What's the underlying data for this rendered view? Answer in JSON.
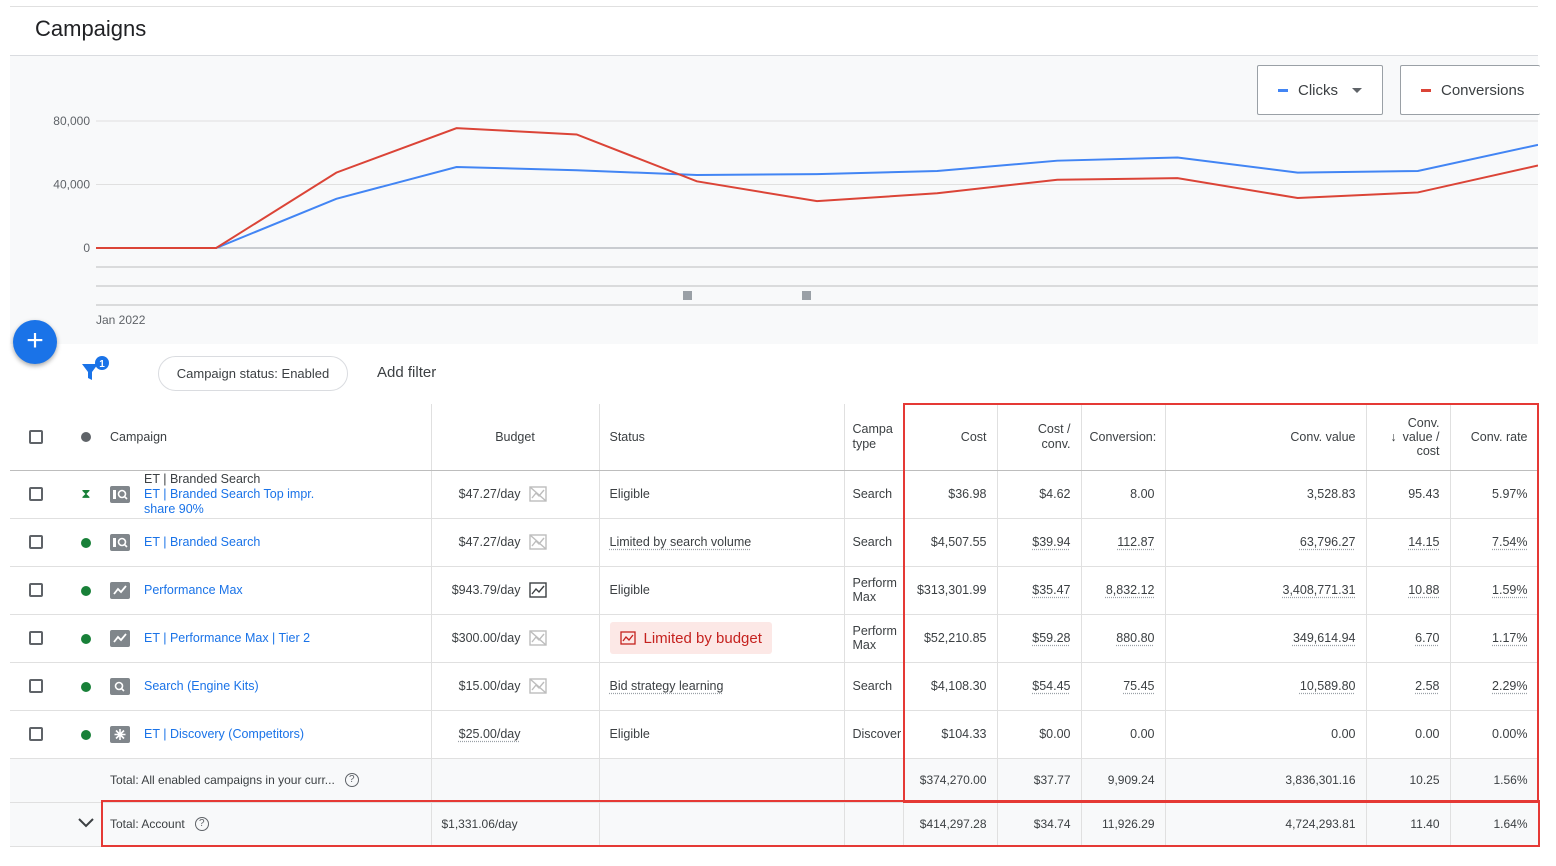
{
  "page": {
    "title": "Campaigns"
  },
  "chart": {
    "metrics": [
      {
        "label": "Clicks",
        "color": "#4285f4",
        "has_dropdown": true
      },
      {
        "label": "Conversions",
        "color": "#db4437",
        "has_dropdown": false
      }
    ],
    "y_tick_labels": [
      "80,000",
      "40,000",
      "0"
    ],
    "x_tick_label": "Jan 2022"
  },
  "chart_data": {
    "type": "line",
    "title": "",
    "xlabel": "",
    "ylabel": "",
    "x_start_label": "Jan 2022",
    "ylim": [
      0,
      80000
    ],
    "y_ticks": [
      0,
      40000,
      80000
    ],
    "grid": true,
    "x": [
      0,
      1,
      2,
      3,
      4,
      5,
      6,
      7,
      8,
      9,
      10,
      11,
      12
    ],
    "series": [
      {
        "name": "Clicks",
        "color": "#4285f4",
        "values": [
          0,
          0,
          31000,
          51000,
          49000,
          46000,
          46500,
          48500,
          55000,
          57000,
          47500,
          48500,
          65000
        ]
      },
      {
        "name": "Conversions",
        "color": "#db4437",
        "values": [
          0,
          0,
          47500,
          75500,
          71500,
          42000,
          29500,
          34500,
          43000,
          44000,
          31500,
          35000,
          52000
        ]
      }
    ]
  },
  "filters": {
    "active_count": "1",
    "chip_label": "Campaign status: Enabled",
    "add_filter_label": "Add filter"
  },
  "table": {
    "headers": {
      "campaign": "Campaign",
      "budget": "Budget",
      "status": "Status",
      "campaign_type_1": "Campa",
      "campaign_type_2": "type",
      "cost": "Cost",
      "cost_conv_1": "Cost /",
      "cost_conv_2": "conv.",
      "conversions": "Conversion:",
      "conv_value": "Conv. value",
      "value_cost_1": "Conv.",
      "value_cost_2": "value /",
      "value_cost_3": "cost",
      "sort_arrow": "↓",
      "conv_rate": "Conv. rate"
    },
    "rows": [
      {
        "status_icon": "hourglass-icon",
        "type_icon": "search-icon",
        "name_line1": "ET | Branded Search",
        "name_line2": "ET | Branded Search Top impr.",
        "name_line3": "share 90%",
        "budget": "$47.27/day",
        "budget_icon": "chart-disabled-icon",
        "status": "Eligible",
        "type": "Search",
        "cost": "$36.98",
        "cost_conv": "$4.62",
        "conversions": "8.00",
        "conv_value": "3,528.83",
        "value_cost": "95.43",
        "conv_rate": "5.97%"
      },
      {
        "status_icon": "green-dot",
        "type_icon": "search-icon",
        "name": "ET | Branded Search",
        "budget": "$47.27/day",
        "budget_icon": "chart-disabled-icon",
        "status": "Limited by search volume",
        "type": "Search",
        "cost": "$4,507.55",
        "cost_conv": "$39.94",
        "conversions": "112.87",
        "conv_value": "63,796.27",
        "value_cost": "14.15",
        "conv_rate": "7.54%"
      },
      {
        "status_icon": "green-dot",
        "type_icon": "performance-max-icon",
        "name": "Performance Max",
        "budget": "$943.79/day",
        "budget_icon": "chart-icon",
        "status": "Eligible",
        "type_1": "Perform",
        "type_2": "Max",
        "cost": "$313,301.99",
        "cost_conv": "$35.47",
        "conversions": "8,832.12",
        "conv_value": "3,408,771.31",
        "value_cost": "10.88",
        "conv_rate": "1.59%"
      },
      {
        "status_icon": "green-dot",
        "type_icon": "performance-max-icon",
        "name": "ET | Performance Max | Tier 2",
        "budget": "$300.00/day",
        "budget_icon": "chart-disabled-icon",
        "status_badge": "Limited by budget",
        "type_1": "Perform",
        "type_2": "Max",
        "cost": "$52,210.85",
        "cost_conv": "$59.28",
        "conversions": "880.80",
        "conv_value": "349,614.94",
        "value_cost": "6.70",
        "conv_rate": "1.17%"
      },
      {
        "status_icon": "green-dot",
        "type_icon": "search-icon",
        "name": "Search (Engine Kits)",
        "budget": "$15.00/day",
        "budget_icon": "chart-disabled-icon",
        "status": "Bid strategy learning",
        "type": "Search",
        "cost": "$4,108.30",
        "cost_conv": "$54.45",
        "conversions": "75.45",
        "conv_value": "10,589.80",
        "value_cost": "2.58",
        "conv_rate": "2.29%"
      },
      {
        "status_icon": "green-dot",
        "type_icon": "discovery-icon",
        "name": "ET | Discovery (Competitors)",
        "budget": "$25.00/day",
        "status": "Eligible",
        "type": "Discover",
        "cost": "$104.33",
        "cost_conv": "$0.00",
        "conversions": "0.00",
        "conv_value": "0.00",
        "value_cost": "0.00",
        "conv_rate": "0.00%"
      }
    ],
    "total_enabled": {
      "label": "Total: All enabled campaigns in your curr...",
      "cost": "$374,270.00",
      "cost_conv": "$37.77",
      "conversions": "9,909.24",
      "conv_value": "3,836,301.16",
      "value_cost": "10.25",
      "conv_rate": "1.56%"
    },
    "total_account": {
      "label": "Total: Account",
      "budget": "$1,331.06/day",
      "cost": "$414,297.28",
      "cost_conv": "$34.74",
      "conversions": "11,926.29",
      "conv_value": "4,724,293.81",
      "value_cost": "11.40",
      "conv_rate": "1.64%"
    },
    "help_glyph": "?"
  },
  "colors": {
    "accent": "#1a73e8",
    "clicks": "#4285f4",
    "conversions": "#db4437",
    "highlight": "#e53935",
    "eligible": "#188038"
  }
}
